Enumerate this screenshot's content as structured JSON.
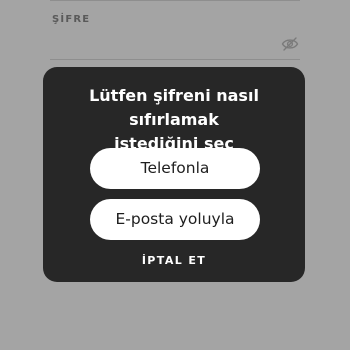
{
  "form": {
    "password_label": "ŞİFRE",
    "visibility_icon": "eye-slash-icon"
  },
  "dialog": {
    "title_line1": "Lütfen şifreni nasıl sıfırlamak",
    "title_line2": "istediğini seç",
    "options": [
      {
        "label": "Telefonla"
      },
      {
        "label": "E-posta yoluyla"
      }
    ],
    "cancel_label": "İPTAL ET"
  },
  "colors": {
    "overlay_background": "#a4a4a4",
    "dialog_background": "#272727",
    "button_background": "#ffffff",
    "button_text": "#1e1e1e",
    "dialog_text": "#ffffff"
  }
}
